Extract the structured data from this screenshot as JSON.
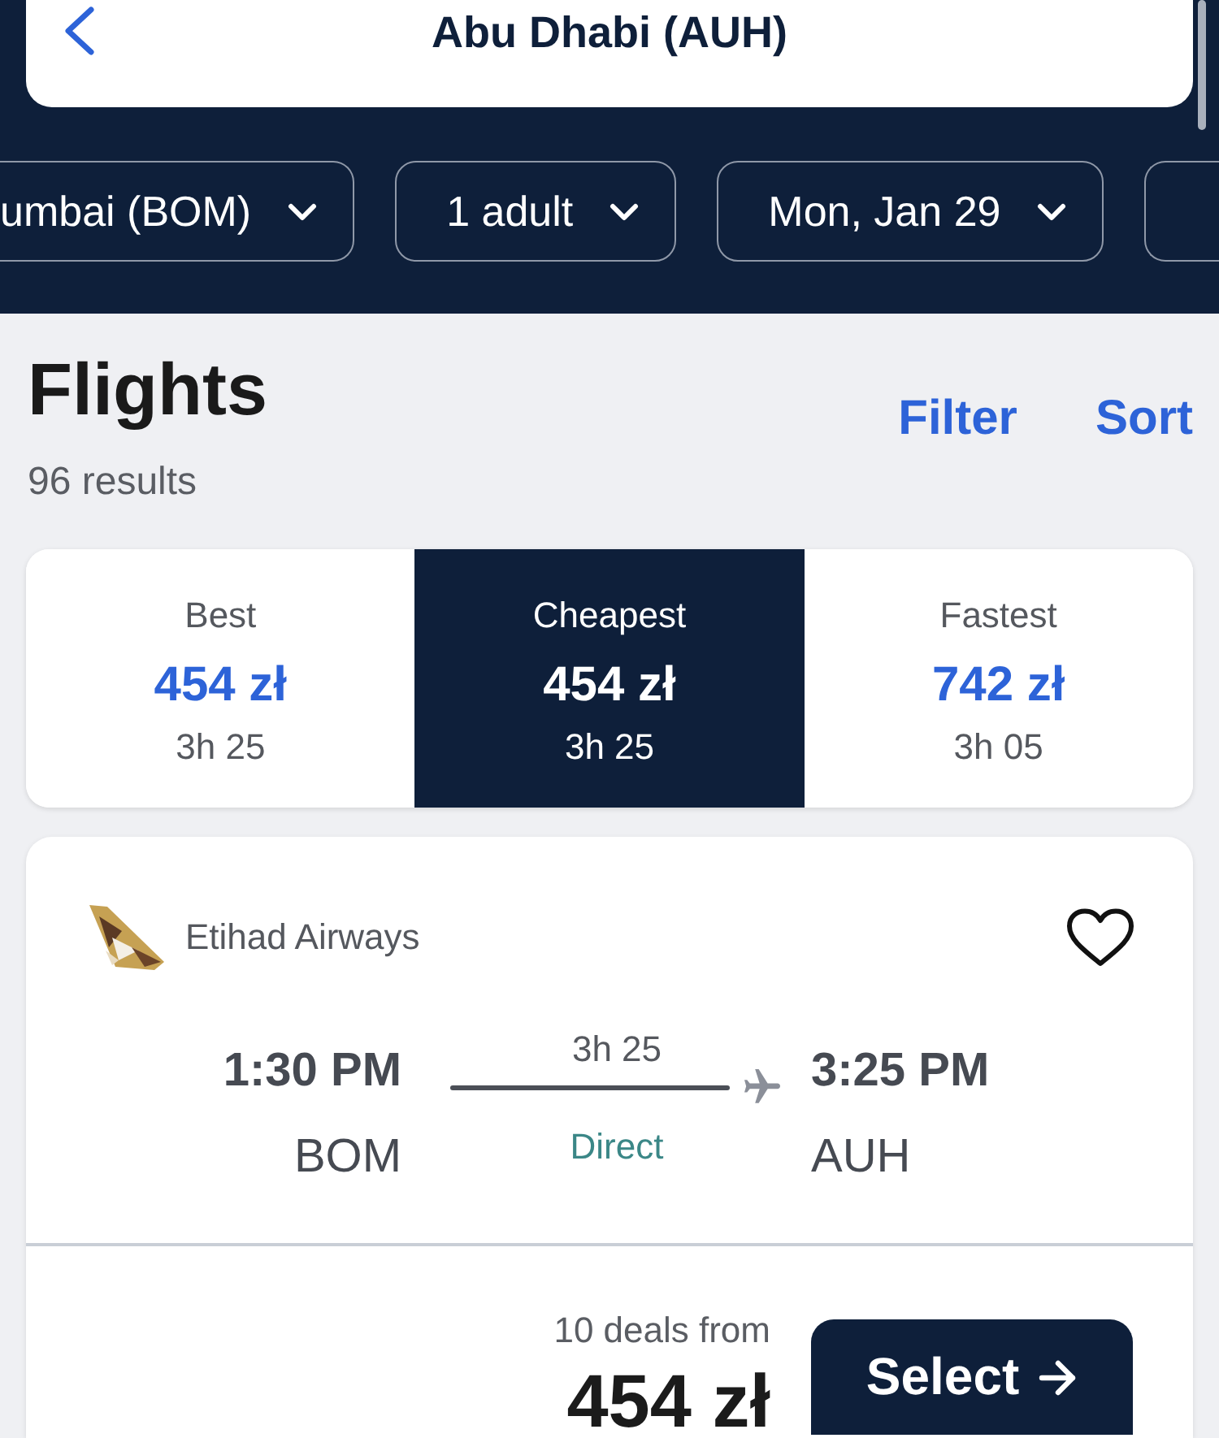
{
  "header": {
    "title": "Abu Dhabi (AUH)"
  },
  "search_chips": [
    {
      "label": "umbai (BOM)"
    },
    {
      "label": "1 adult"
    },
    {
      "label": "Mon, Jan 29"
    }
  ],
  "more_chips_cut_off": true,
  "results": {
    "title": "Flights",
    "count": "96 results",
    "actions": [
      {
        "label": "Filter"
      },
      {
        "label": "Sort"
      }
    ]
  },
  "sort_tabs": [
    {
      "label": "Best",
      "price": "454 zł",
      "duration": "3h 25",
      "selected": false
    },
    {
      "label": "Cheapest",
      "price": "454 zł",
      "duration": "3h 25",
      "selected": true
    },
    {
      "label": "Fastest",
      "price": "742 zł",
      "duration": "3h 05",
      "selected": false
    }
  ],
  "flights": [
    {
      "airline": "Etihad Airways",
      "saved": false,
      "departure": {
        "time": "1:30 PM",
        "airport": "BOM"
      },
      "duration": "3h 25",
      "stops": "Direct",
      "arrival": {
        "time": "3:25 PM",
        "airport": "AUH"
      },
      "deals": "10 deals from",
      "price": "454 zł",
      "button": "Select"
    }
  ]
}
